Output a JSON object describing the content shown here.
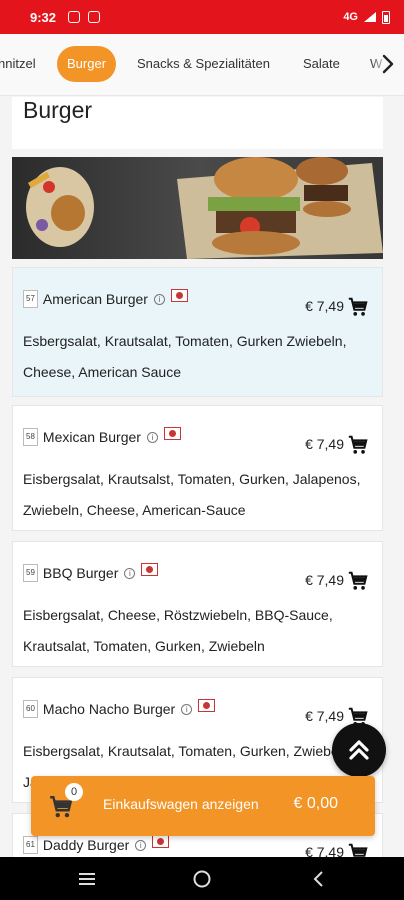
{
  "status_bar": {
    "time": "9:32",
    "network": "4G"
  },
  "categories": [
    {
      "label": "Schnitzel",
      "display": "hnitzel",
      "active": false
    },
    {
      "label": "Burger",
      "display": "Burger",
      "active": true
    },
    {
      "label": "Snacks & Spezialitäten",
      "display": "Snacks & Spezialitäten",
      "active": false
    },
    {
      "label": "Salate",
      "display": "Salate",
      "active": false
    },
    {
      "label": "W",
      "display": "W",
      "active": false
    }
  ],
  "section": {
    "title": "Burger"
  },
  "items": [
    {
      "number": "57",
      "name": "American Burger",
      "price": "€ 7,49",
      "description": "Esbergsalat, Krautsalat, Tomaten, Gurken Zwiebeln, Cheese, American Sauce",
      "highlighted": true
    },
    {
      "number": "58",
      "name": "Mexican Burger",
      "price": "€ 7,49",
      "description": "Eisbergsalat, Krautsalst, Tomaten, Gurken, Jalapenos, Zwiebeln, Cheese, American-Sauce",
      "highlighted": false
    },
    {
      "number": "59",
      "name": "BBQ Burger",
      "price": "€ 7,49",
      "description": "Eisbergsalat, Cheese, Röstzwiebeln, BBQ-Sauce, Krautsalat, Tomaten, Gurken, Zwiebeln",
      "highlighted": false
    },
    {
      "number": "60",
      "name": "Macho Nacho Burger",
      "price": "€ 7,49",
      "description": "Eisbergsalat, Krautsalat, Tomaten, Gurken, Zwiebeln, Jalapenos, Tortilla Chips, Cheese and Salsa",
      "highlighted": false
    },
    {
      "number": "61",
      "name": "Daddy Burger",
      "price": "€ 7,49",
      "description": "",
      "highlighted": false
    }
  ],
  "cart": {
    "count": "0",
    "label": "Einkaufswagen anzeigen",
    "total": "€ 0,00"
  },
  "colors": {
    "status_bar": "#e3141b",
    "accent": "#f39426",
    "highlight": "#e9f5f8"
  },
  "icons": {
    "cart": "shopping-cart-icon",
    "info": "info-icon",
    "flag": "japan-flag-icon",
    "scroll_top": "double-chevron-up-icon",
    "chevron": "chevron-right-icon"
  }
}
